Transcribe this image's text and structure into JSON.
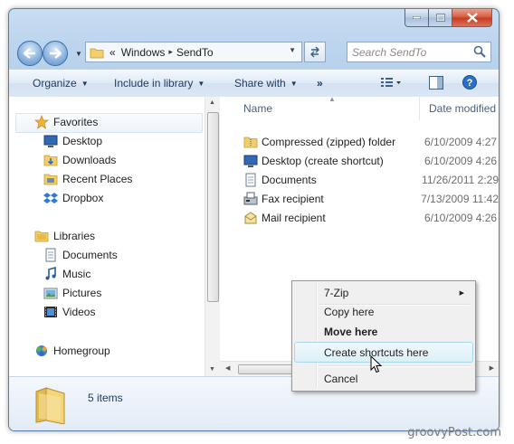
{
  "window": {
    "caption_buttons": [
      "minimize",
      "maximize",
      "close"
    ]
  },
  "address_bar": {
    "breadcrumb_prefix": "«",
    "crumbs": [
      "Windows",
      "SendTo"
    ],
    "separator": "▸"
  },
  "search": {
    "placeholder": "Search SendTo"
  },
  "toolbar": {
    "organize": "Organize",
    "include_in_library": "Include in library",
    "share_with": "Share with",
    "more": "»"
  },
  "nav_pane": {
    "favorites": {
      "label": "Favorites",
      "items": [
        "Desktop",
        "Downloads",
        "Recent Places",
        "Dropbox"
      ]
    },
    "libraries": {
      "label": "Libraries",
      "items": [
        "Documents",
        "Music",
        "Pictures",
        "Videos"
      ]
    },
    "homegroup": "Homegroup"
  },
  "file_list": {
    "columns": {
      "name": "Name",
      "date_modified": "Date modified"
    },
    "rows": [
      {
        "name": "Compressed (zipped) folder",
        "date": "6/10/2009 4:27",
        "icon": "zip-folder-icon"
      },
      {
        "name": "Desktop (create shortcut)",
        "date": "6/10/2009 4:26",
        "icon": "desktop-icon"
      },
      {
        "name": "Documents",
        "date": "11/26/2011 2:29",
        "icon": "document-icon"
      },
      {
        "name": "Fax recipient",
        "date": "7/13/2009 11:42",
        "icon": "fax-icon"
      },
      {
        "name": "Mail recipient",
        "date": "6/10/2009 4:26",
        "icon": "mail-icon"
      }
    ]
  },
  "details_pane": {
    "item_count": "5 items"
  },
  "context_menu": {
    "items": [
      "7-Zip",
      "Copy here",
      "Move here",
      "Create shortcuts here",
      "Cancel"
    ],
    "highlighted": "Create shortcuts here"
  },
  "watermark": "groovyPost.com",
  "colors": {
    "window_frame": "#b7d0ea",
    "toolbar_text": "#1e395b",
    "menu_highlight": "#dcf0f8",
    "folder_yellow": "#f3cf6a"
  }
}
